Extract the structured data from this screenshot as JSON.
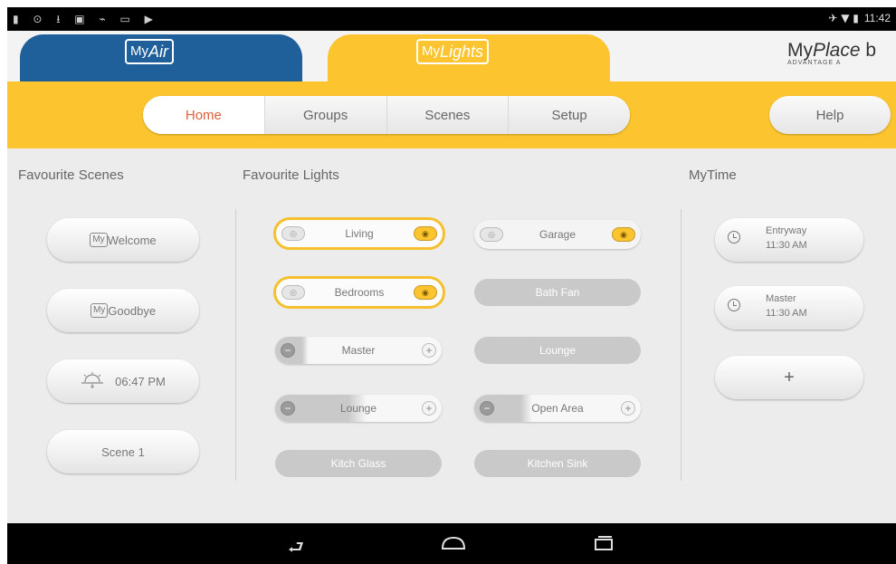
{
  "status_bar": {
    "left_icons": "▮ ⊙ ⭳ ▣ ⌁ ▭ ▶",
    "signal_icons": "✈ ▼ ▮",
    "time": "11:42"
  },
  "tabs": {
    "myair": {
      "my": "My",
      "word": "Air"
    },
    "mylights": {
      "my": "My",
      "word": "Lights"
    }
  },
  "brand": {
    "title_my": "My",
    "title_place": "Place",
    "title_tail": "b",
    "subtitle": "ADVANTAGE A"
  },
  "nav": {
    "segments": [
      "Home",
      "Groups",
      "Scenes",
      "Setup"
    ],
    "active": "Home",
    "help": "Help"
  },
  "sections": {
    "scenes": "Favourite Scenes",
    "lights": "Favourite Lights",
    "mytime": "MyTime"
  },
  "scenes": [
    {
      "my": "My",
      "name": "Welcome"
    },
    {
      "my": "My",
      "name": "Goodbye"
    },
    {
      "time": "06:47 PM"
    },
    {
      "name": "Scene 1"
    }
  ],
  "lights": {
    "living": "Living",
    "garage": "Garage",
    "bedrooms": "Bedrooms",
    "bath_fan": "Bath Fan",
    "master": "Master",
    "lounge_right": "Lounge",
    "lounge_dimmer": "Lounge",
    "open_area": "Open Area",
    "kitch_glass": "Kitch Glass",
    "kitchen_sink": "Kitchen Sink",
    "master_level": 0.2,
    "lounge_level": 0.55,
    "open_area_level": 0.35
  },
  "mytime": [
    {
      "name": "Entryway",
      "time": "11:30 AM"
    },
    {
      "name": "Master",
      "time": "11:30 AM"
    }
  ],
  "mytime_add": "+",
  "colors": {
    "accent_yellow": "#fcc52f",
    "myair_blue": "#1f5f9a",
    "active_text": "#e0603a"
  }
}
